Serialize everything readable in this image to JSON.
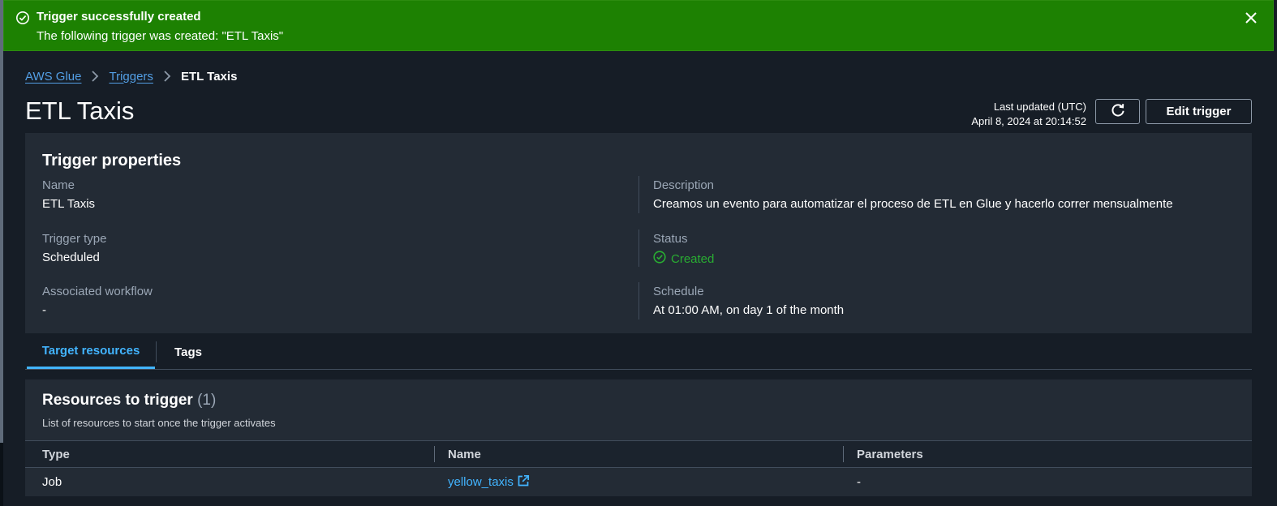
{
  "flash": {
    "title": "Trigger successfully created",
    "message": "The following trigger was created: \"ETL Taxis\"",
    "color": "#1d8102"
  },
  "breadcrumb": {
    "items": [
      "AWS Glue",
      "Triggers",
      "ETL Taxis"
    ]
  },
  "header": {
    "title": "ETL Taxis",
    "last_updated_label": "Last updated (UTC)",
    "last_updated_value": "April 8, 2024 at 20:14:52",
    "edit_label": "Edit trigger"
  },
  "properties": {
    "heading": "Trigger properties",
    "name_label": "Name",
    "name_value": "ETL Taxis",
    "description_label": "Description",
    "description_value": "Creamos un evento para automatizar el proceso de ETL en Glue y hacerlo correr mensualmente",
    "type_label": "Trigger type",
    "type_value": "Scheduled",
    "status_label": "Status",
    "status_value": "Created",
    "workflow_label": "Associated workflow",
    "workflow_value": "-",
    "schedule_label": "Schedule",
    "schedule_value": "At 01:00 AM, on day 1 of the month"
  },
  "tabs": [
    "Target resources",
    "Tags"
  ],
  "resources": {
    "heading": "Resources to trigger",
    "count": "(1)",
    "description": "List of resources to start once the trigger activates",
    "columns": [
      "Type",
      "Name",
      "Parameters"
    ],
    "rows": [
      {
        "type": "Job",
        "name": "yellow_taxis",
        "parameters": "-"
      }
    ]
  },
  "colors": {
    "link": "#42b4ff",
    "success": "#29ad32",
    "panel": "#232b35",
    "background": "#161d26"
  }
}
